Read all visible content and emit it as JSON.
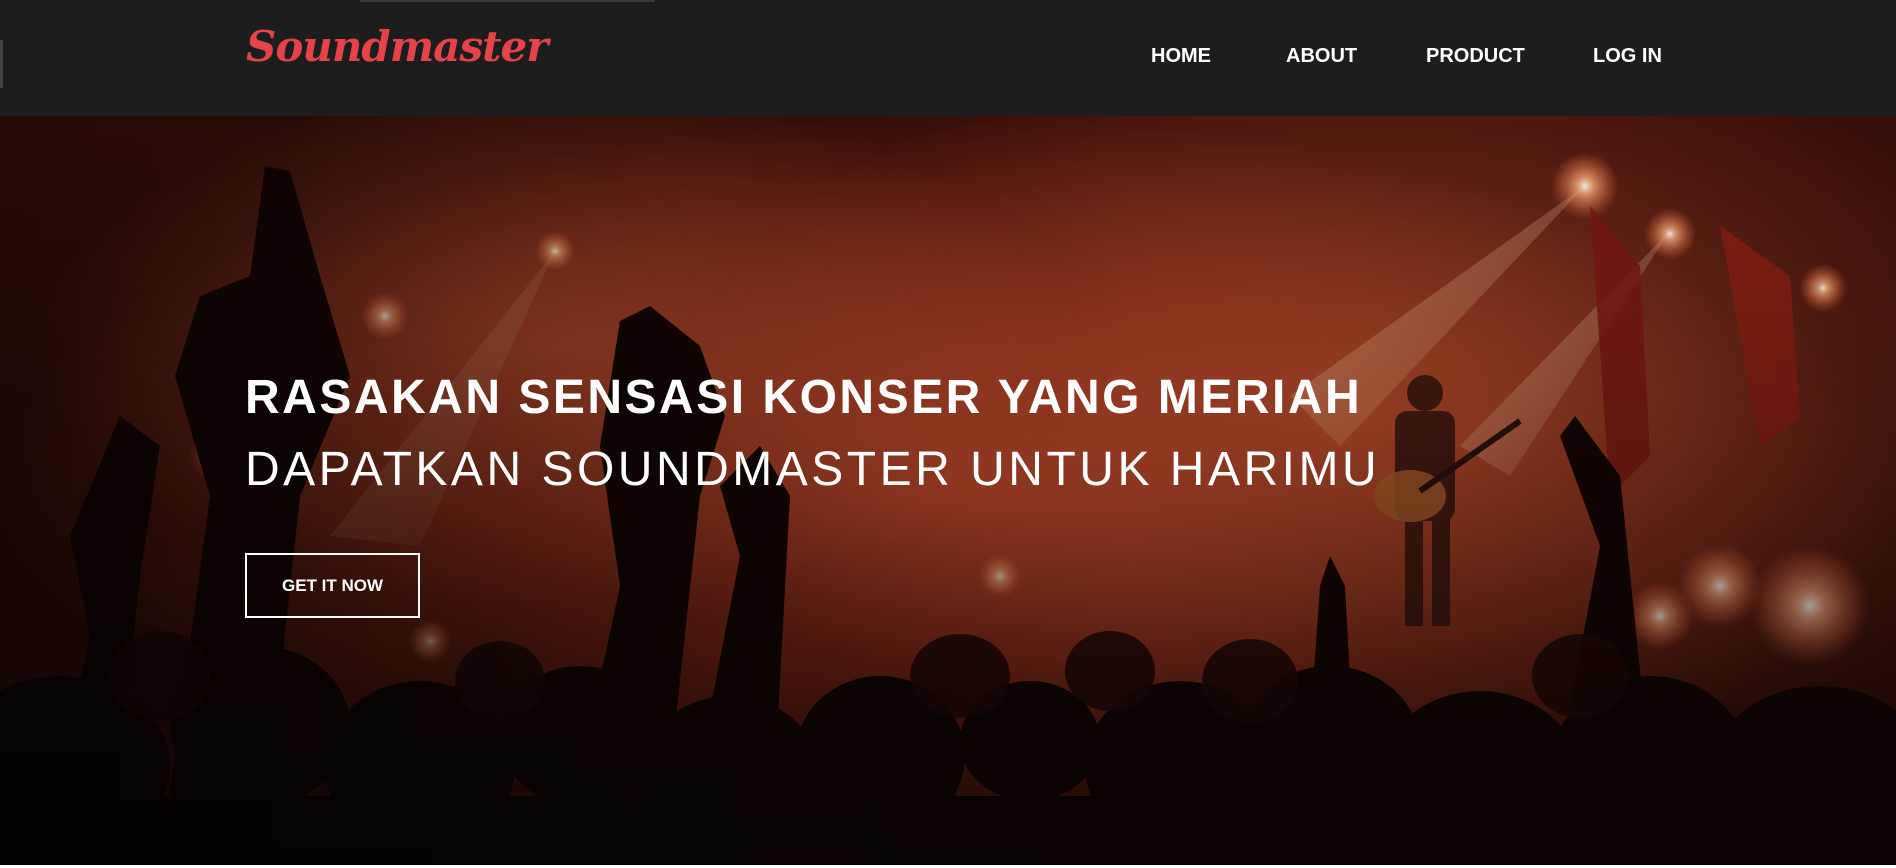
{
  "brand": {
    "name": "Soundmaster",
    "color": "#e4434a"
  },
  "nav": {
    "background": "#1d1d1d",
    "links": [
      {
        "label": "HOME"
      },
      {
        "label": "ABOUT"
      },
      {
        "label": "PRODUCT"
      },
      {
        "label": "LOG IN"
      }
    ]
  },
  "hero": {
    "image": "concert-crowd-photo",
    "headline": "RASAKAN SENSASI KONSER YANG MERIAH",
    "subheadline": "DAPATKAN SOUNDMASTER UNTUK HARIMU",
    "cta_label": "GET IT NOW"
  }
}
